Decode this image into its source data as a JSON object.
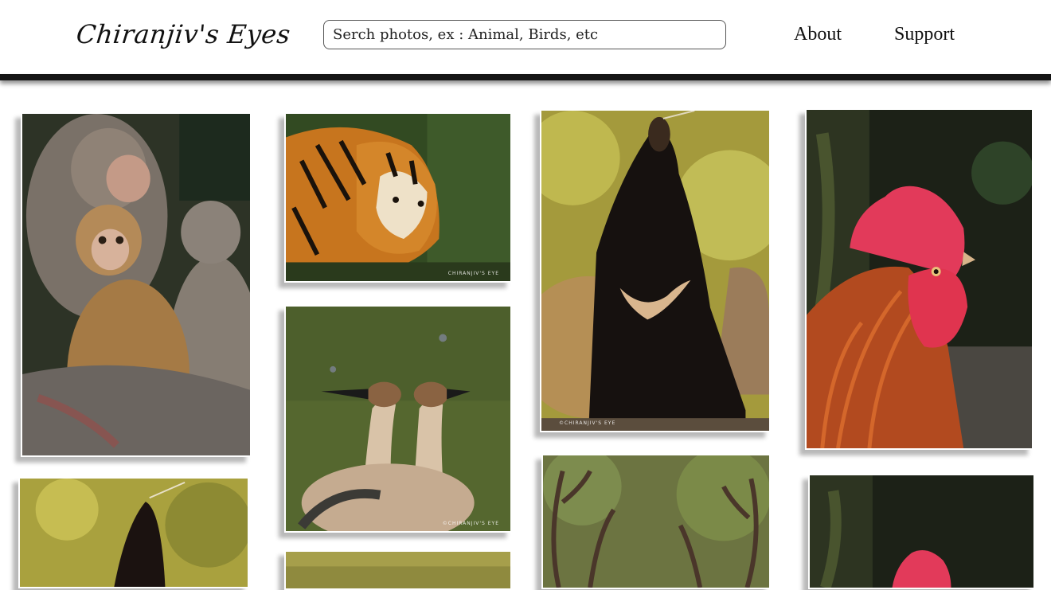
{
  "header": {
    "logo": "Chiranjiv's Eyes",
    "search_placeholder": "Serch photos, ex : Animal, Birds, etc",
    "nav": {
      "about": "About",
      "support": "Support"
    }
  },
  "gallery": {
    "watermarks": {
      "tiger": "CHIRANJIV'S EYE",
      "geese": "©CHIRANJIV'S EYE",
      "bear": "©CHIRANJIV'S EYE"
    }
  }
}
